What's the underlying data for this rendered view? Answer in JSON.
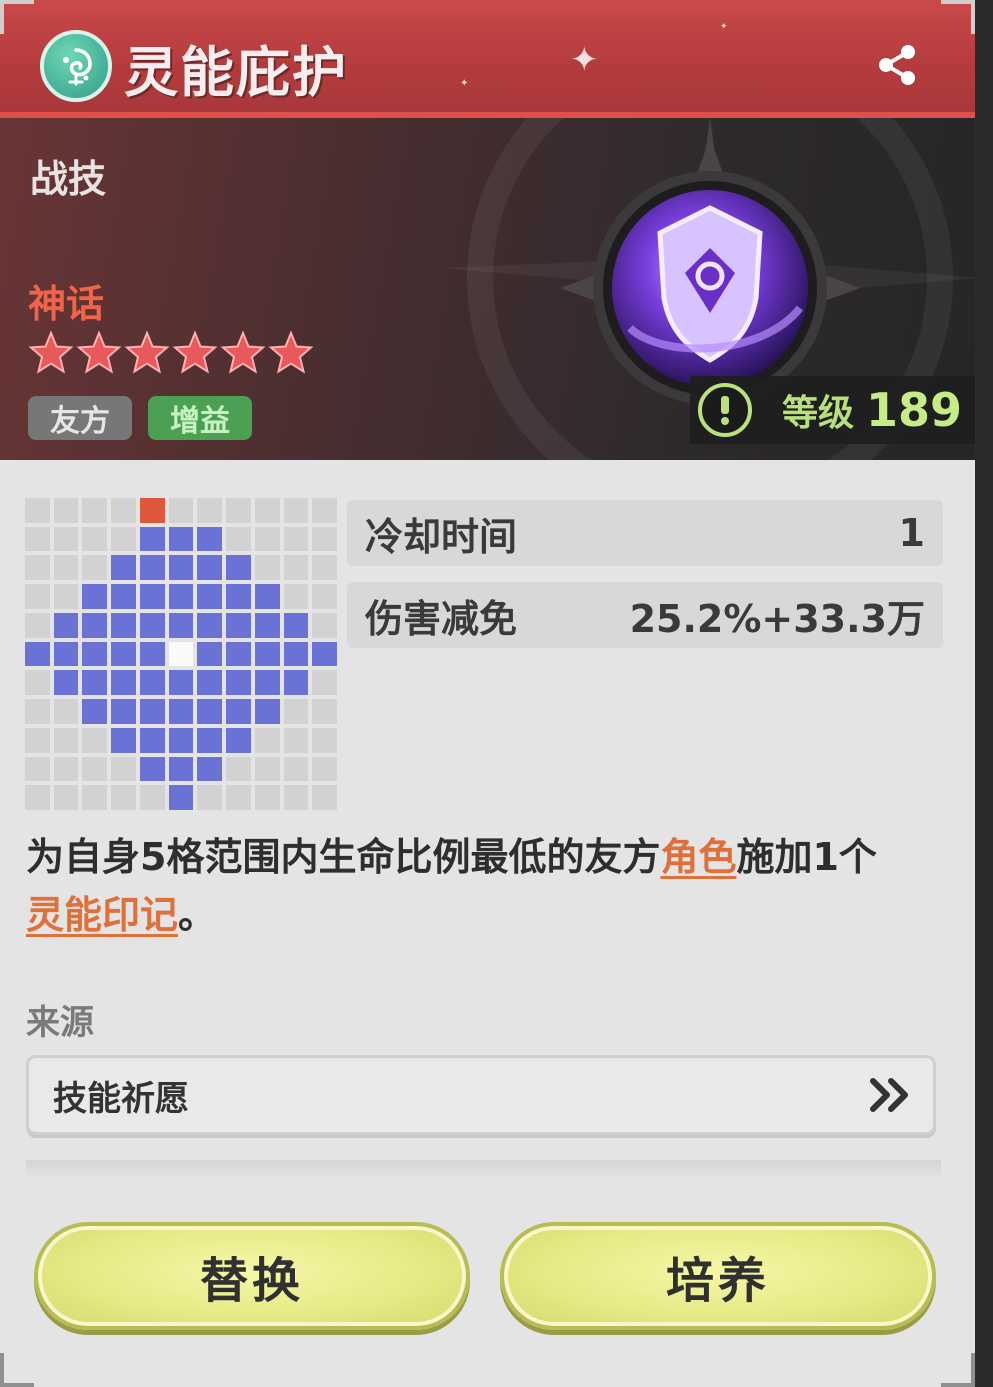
{
  "header": {
    "title": "灵能庇护",
    "emblem_icon": "swirl-emblem-icon",
    "share_icon": "share-icon"
  },
  "banner": {
    "skill_type": "战技",
    "rarity": "神话",
    "stars": 6,
    "tags": [
      "友方",
      "增益"
    ],
    "level_label": "等级",
    "level_value": "189"
  },
  "range_grid": {
    "size": 11,
    "rows": [
      "....R......",
      "....BBB....",
      "...BBBBB...",
      "..BBBBBBB..",
      ".BBBBBBBBB.",
      "BBBBBWBBBBBB",
      ".BBBBBBBBB.",
      "..BBBBBBB..",
      "...BBBBB...",
      "....BBB....",
      ".....B....."
    ]
  },
  "stats": [
    {
      "name": "冷却时间",
      "value": "1"
    },
    {
      "name": "伤害减免",
      "value": "25.2%+33.3万"
    }
  ],
  "description": {
    "part1": "为自身5格范围内生命比例最低的友方",
    "keyword1": "角色",
    "part2": "施加1个",
    "keyword2": "灵能印记",
    "part3": "。"
  },
  "source": {
    "label": "来源",
    "item": "技能祈愿"
  },
  "buttons": {
    "replace": "替换",
    "cultivate": "培养"
  },
  "colors": {
    "title_bar": "#b33a3c",
    "rarity": "#f0644a",
    "range_cell": "#6b72d6",
    "origin_cell": "#e0583b",
    "keyword": "#e0703a",
    "button": "#e7ea86",
    "level": "#c6ec85"
  }
}
